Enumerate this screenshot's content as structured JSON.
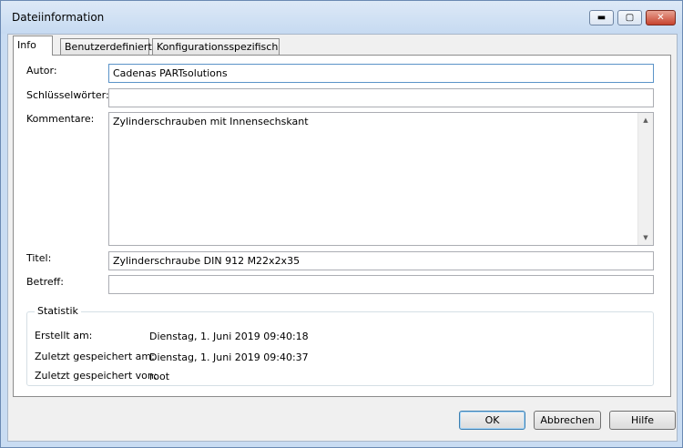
{
  "window": {
    "title": "Dateiinformation",
    "controls": {
      "minimize": "▬",
      "maximize": "▢",
      "close": "✕"
    }
  },
  "tabs": [
    {
      "label": "Info",
      "active": true
    },
    {
      "label": "Benutzerdefiniert",
      "active": false
    },
    {
      "label": "Konfigurationsspezifisch",
      "active": false
    }
  ],
  "info": {
    "author": {
      "label": "Autor:",
      "value": "Cadenas PARTsolutions"
    },
    "keywords": {
      "label": "Schlüsselwörter:",
      "value": ""
    },
    "comments": {
      "label": "Kommentare:",
      "value": "Zylinderschrauben mit Innensechskant"
    },
    "title": {
      "label": "Titel:",
      "value": "Zylinderschraube DIN 912 M22x2x35"
    },
    "subject": {
      "label": "Betreff:",
      "value": ""
    }
  },
  "statistics": {
    "caption": "Statistik",
    "created": {
      "label": "Erstellt am:",
      "value": "Dienstag, 1. Juni 2019 09:40:18"
    },
    "saved": {
      "label": "Zuletzt gespeichert am:",
      "value": "Dienstag, 1. Juni 2019 09:40:37"
    },
    "saved_by": {
      "label": "Zuletzt gespeichert von:",
      "value": "root"
    }
  },
  "buttons": {
    "ok": "OK",
    "cancel": "Abbrechen",
    "help": "Hilfe"
  },
  "colors": {
    "title_bar": "#c6daf1",
    "close_button": "#c7432e",
    "focus_border": "#5b93c8"
  }
}
